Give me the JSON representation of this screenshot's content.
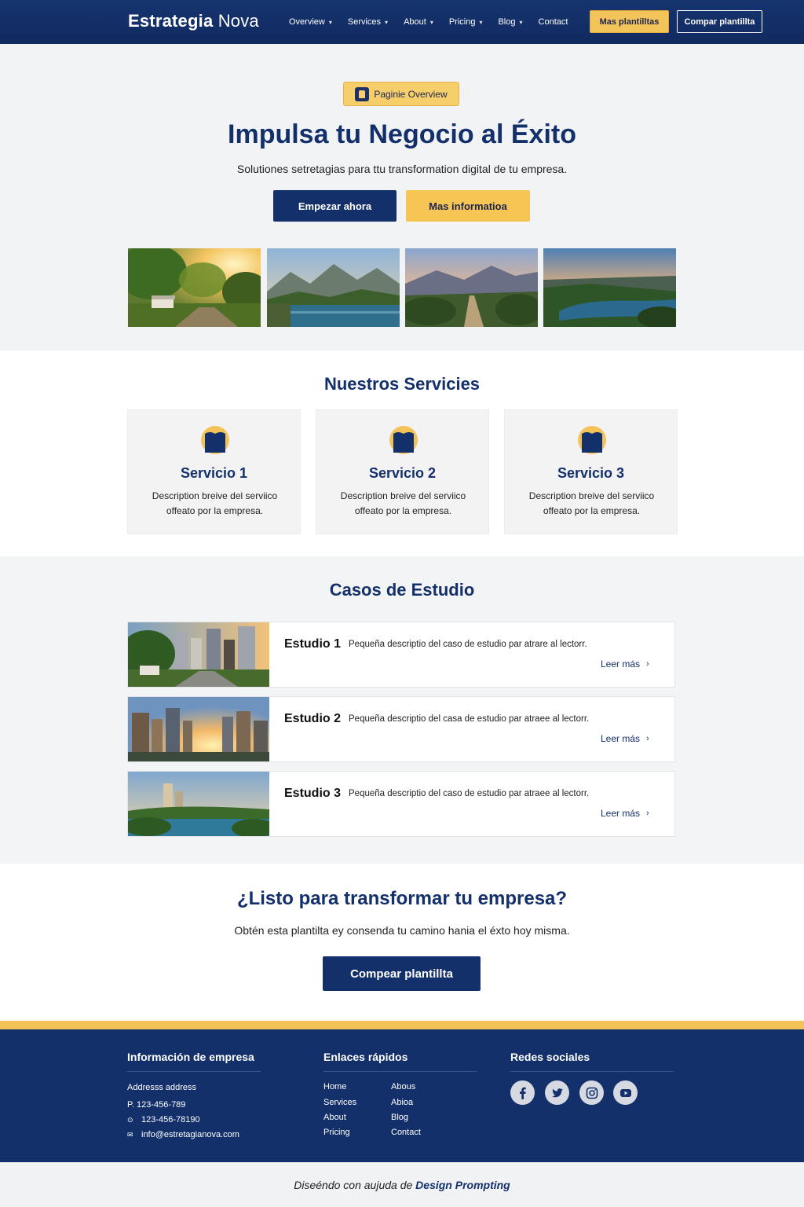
{
  "nav": {
    "brand_bold": "Estrategia",
    "brand_light": "Nova",
    "links": [
      {
        "label": "Overview",
        "dropdown": true
      },
      {
        "label": "Services",
        "dropdown": true
      },
      {
        "label": "About",
        "dropdown": true
      },
      {
        "label": "Pricing",
        "dropdown": true
      },
      {
        "label": "Blog",
        "dropdown": true
      },
      {
        "label": "Contact",
        "dropdown": false
      }
    ],
    "cta_gold": "Mas plantilltas",
    "cta_outline": "Compar plantillta"
  },
  "hero": {
    "badge": "Paginie Overview",
    "title": "Impulsa tu Negocio al Éxito",
    "subtitle": "Solutiones setretagias para ttu transformation digital de tu empresa.",
    "btn_primary": "Empezar ahora",
    "btn_secondary": "Mas informatioa"
  },
  "services": {
    "title": "Nuestros Servicies",
    "items": [
      {
        "name": "Servicio 1",
        "desc": "Description breive del serviico offeato por la empresa."
      },
      {
        "name": "Servicio 2",
        "desc": "Description breive del serviico offeato por la empresa."
      },
      {
        "name": "Servicio 3",
        "desc": "Description breive del serviico offeato por la empresa."
      }
    ]
  },
  "cases": {
    "title": "Casos de Estudio",
    "items": [
      {
        "title": "Estudio 1",
        "desc": "Pequeña descriptio del caso de estudio par atrare al lectorr.",
        "more": "Leer más"
      },
      {
        "title": "Estudio 2",
        "desc": "Pequeña descriptio del casa de estudio par atraee al lectorr.",
        "more": "Leer más"
      },
      {
        "title": "Estudio 3",
        "desc": "Pequeña descriptio del caso de estudio par atraee al lectorr.",
        "more": "Leer más"
      }
    ]
  },
  "cta": {
    "title": "¿Listo para transformar tu empresa?",
    "subtitle": "Obtén esta plantilta ey consenda tu camino hania el éxto hoy misma.",
    "button": "Compear plantillta"
  },
  "footer": {
    "company_title": "Información de empresa",
    "address": "Addresss address",
    "phone": "P. 123-456-789",
    "phone2": "123-456-78190",
    "email": "info@estretagianova.com",
    "links_title": "Enlaces rápidos",
    "links_col1": [
      "Home",
      "Services",
      "About",
      "Pricing"
    ],
    "links_col2": [
      "Abous",
      "Abioa",
      "Blog",
      "Contact"
    ],
    "social_title": "Redes sociales",
    "social": [
      "facebook-icon",
      "twitter-icon",
      "instagram-icon",
      "youtube-icon"
    ]
  },
  "credit": {
    "prefix": "Diseéndo con aujuda de",
    "brand": "Design Prompting"
  },
  "colors": {
    "navy": "#14306b",
    "gold": "#f3c45a",
    "light_bg": "#f2f3f5"
  }
}
